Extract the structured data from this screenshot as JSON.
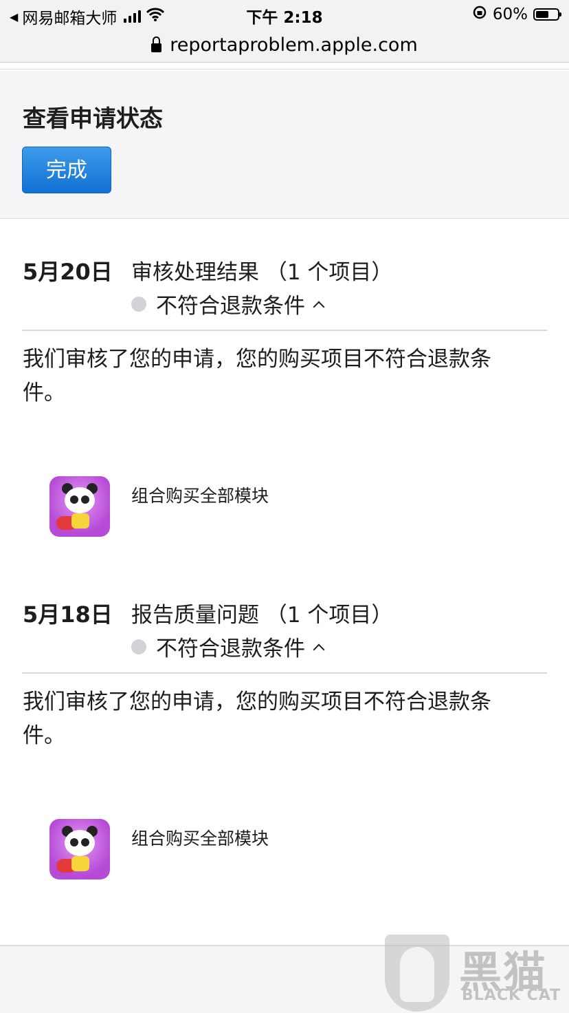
{
  "status_bar": {
    "back_app": "网易邮箱大师",
    "time": "下午 2:18",
    "battery": "60%",
    "battery_level": 0.6
  },
  "browser": {
    "url": "reportaproblem.apple.com"
  },
  "header": {
    "title": "查看申请状态",
    "done_label": "完成"
  },
  "requests": [
    {
      "date": "5月20日",
      "title": "审核处理结果 （1 个项目）",
      "status": "不符合退款条件",
      "message": "我们审核了您的申请，您的购买项目不符合退款条件。",
      "item_name": "组合购买全部模块",
      "item_icon": "baby-panda-app-icon"
    },
    {
      "date": "5月18日",
      "title": "报告质量问题 （1 个项目）",
      "status": "不符合退款条件",
      "message": "我们审核了您的申请，您的购买项目不符合退款条件。",
      "item_name": "组合购买全部模块",
      "item_icon": "baby-panda-app-icon"
    }
  ],
  "watermark": {
    "text": "黑猫",
    "sub": "BLACK CAT"
  }
}
